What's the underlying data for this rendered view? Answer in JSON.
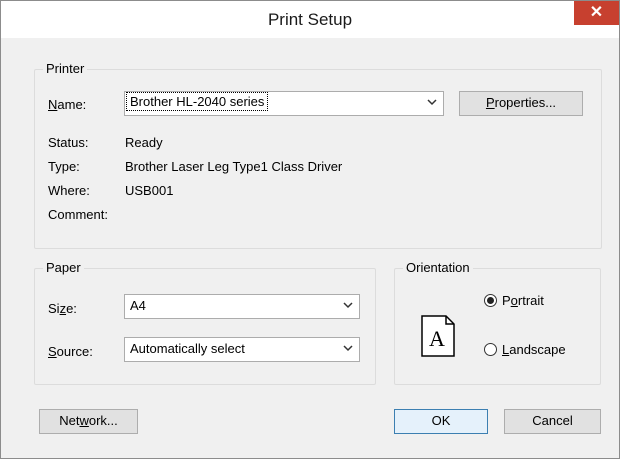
{
  "window": {
    "title": "Print Setup",
    "close_symbol": "✕"
  },
  "printer": {
    "group_label": "Printer",
    "name_label": "Name:",
    "name_accel": "N",
    "name_rest": "ame:",
    "selected": "Brother HL-2040 series",
    "properties_button": {
      "before": "",
      "accel": "P",
      "after": "roperties..."
    },
    "status_label": "Status:",
    "status_value": "Ready",
    "type_label": "Type:",
    "type_value": "Brother Laser Leg Type1 Class Driver",
    "where_label": "Where:",
    "where_value": "USB001",
    "comment_label": "Comment:",
    "comment_value": ""
  },
  "paper": {
    "group_label": "Paper",
    "size_label": {
      "before": "Si",
      "accel": "z",
      "after": "e:"
    },
    "size_value": "A4",
    "source_label": {
      "before": "",
      "accel": "S",
      "after": "ource:"
    },
    "source_value": "Automatically select"
  },
  "orientation": {
    "group_label": "Orientation",
    "icon_letter": "A",
    "portrait": {
      "before": "P",
      "accel": "o",
      "after": "rtrait",
      "selected": true
    },
    "landscape": {
      "before": "",
      "accel": "L",
      "after": "andscape",
      "selected": false
    }
  },
  "buttons": {
    "network": {
      "before": "Net",
      "accel": "w",
      "after": "ork..."
    },
    "ok": "OK",
    "cancel": "Cancel"
  },
  "icons": {
    "dropdown": "chevron-down-icon",
    "close": "close-icon",
    "orientation": "portrait-page-icon"
  }
}
